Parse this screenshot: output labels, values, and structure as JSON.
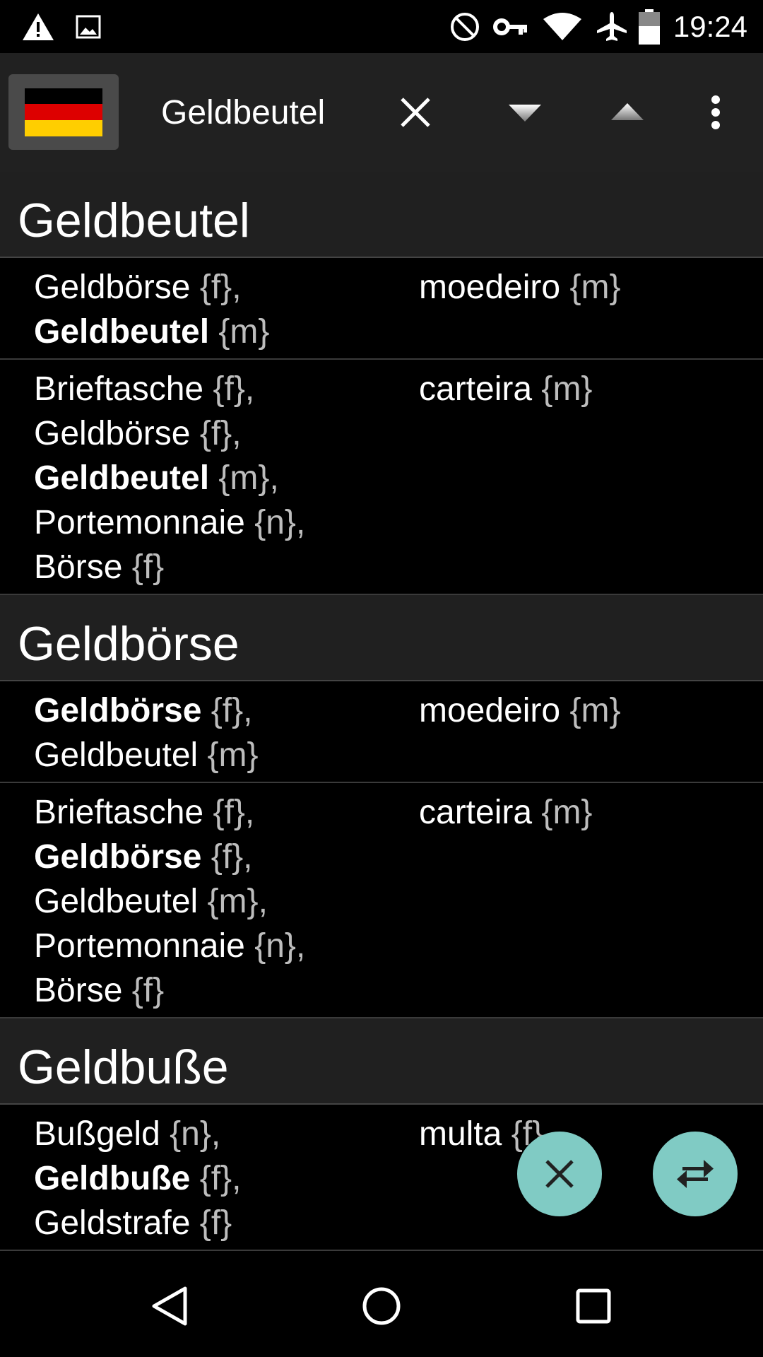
{
  "status_bar": {
    "time": "19:24",
    "icons": [
      "warning-icon",
      "image-icon",
      "do-not-disturb-icon",
      "vpn-key-icon",
      "wifi-icon",
      "airplane-icon",
      "battery-icon"
    ]
  },
  "toolbar": {
    "language_flag": "german-flag",
    "flag_colors": [
      "#000000",
      "#dd0000",
      "#ffce00"
    ],
    "search_query": "Geldbeutel",
    "icons": [
      "clear-icon",
      "next-down-icon",
      "previous-up-icon",
      "more-options-icon"
    ]
  },
  "results": [
    {
      "header": "Geldbeutel",
      "rows": [
        {
          "left": [
            {
              "word": "Geldbörse",
              "gender": "{f}",
              "sep": ",",
              "bold": false
            },
            {
              "word": "Geldbeutel",
              "gender": "{m}",
              "sep": "",
              "bold": true
            }
          ],
          "right": {
            "word": "moedeiro",
            "gender": "{m}"
          }
        },
        {
          "left": [
            {
              "word": "Brieftasche",
              "gender": "{f}",
              "sep": ",",
              "bold": false
            },
            {
              "word": "Geldbörse",
              "gender": "{f}",
              "sep": ",",
              "bold": false
            },
            {
              "word": "Geldbeutel",
              "gender": "{m}",
              "sep": ",",
              "bold": true
            },
            {
              "word": "Portemonnaie",
              "gender": "{n}",
              "sep": ",",
              "bold": false
            },
            {
              "word": "Börse",
              "gender": "{f}",
              "sep": "",
              "bold": false
            }
          ],
          "right": {
            "word": "carteira",
            "gender": "{m}"
          }
        }
      ]
    },
    {
      "header": "Geldbörse",
      "rows": [
        {
          "left": [
            {
              "word": "Geldbörse",
              "gender": "{f}",
              "sep": ",",
              "bold": true
            },
            {
              "word": "Geldbeutel",
              "gender": "{m}",
              "sep": "",
              "bold": false
            }
          ],
          "right": {
            "word": "moedeiro",
            "gender": "{m}"
          }
        },
        {
          "left": [
            {
              "word": "Brieftasche",
              "gender": "{f}",
              "sep": ",",
              "bold": false
            },
            {
              "word": "Geldbörse",
              "gender": "{f}",
              "sep": ",",
              "bold": true
            },
            {
              "word": "Geldbeutel",
              "gender": "{m}",
              "sep": ",",
              "bold": false
            },
            {
              "word": "Portemonnaie",
              "gender": "{n}",
              "sep": ",",
              "bold": false
            },
            {
              "word": "Börse",
              "gender": "{f}",
              "sep": "",
              "bold": false
            }
          ],
          "right": {
            "word": "carteira",
            "gender": "{m}"
          }
        }
      ]
    },
    {
      "header": "Geldbuße",
      "rows": [
        {
          "left": [
            {
              "word": "Bußgeld",
              "gender": "{n}",
              "sep": ",",
              "bold": false
            },
            {
              "word": "Geldbuße",
              "gender": "{f}",
              "sep": ",",
              "bold": true
            },
            {
              "word": "Geldstrafe",
              "gender": "{f}",
              "sep": "",
              "bold": false
            }
          ],
          "right": {
            "word": "multa",
            "gender": "{f}"
          }
        }
      ]
    }
  ],
  "fabs": {
    "clear": "close-icon",
    "swap": "swap-languages-icon",
    "color": "#80cbc4"
  },
  "nav_bar": {
    "icons": [
      "back-icon",
      "home-icon",
      "recents-icon"
    ]
  }
}
